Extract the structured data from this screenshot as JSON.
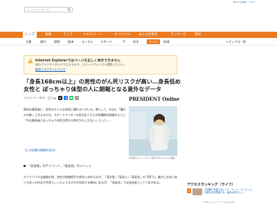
{
  "header": {
    "top_links": "Yahoo! JAPAN　ヘルプ",
    "search_placeholder": "キーワードを入力"
  },
  "nav": {
    "items": [
      "トップ",
      "速報",
      "ライブ",
      "エキスパート",
      "オリジナル",
      "みんなの意見",
      "ランキング",
      "有料"
    ],
    "active_index": 0,
    "accent_color": "#ea7a1f"
  },
  "subnav": {
    "items": [
      "主要",
      "国内",
      "国際",
      "経済",
      "エンタメ",
      "スポーツ",
      "IT",
      "科学",
      "ライフ",
      "地域"
    ],
    "active_index": 8,
    "right_label": "トピックス一覧"
  },
  "warning": {
    "title": "Internet Explorerではページを正しく表示できません",
    "body": "他のブラウザーからアクセスするか、スマートフォンから閲覧ください。",
    "link": "推奨ブラウザーについて"
  },
  "article": {
    "headline": "「身長168cm以上」の男性のがん死リスクが高い…身長低め女性と ぽっちゃり体型の人に朗報となる意外なデータ",
    "date": "3/3(日) 10:17配信",
    "comment_count": "36",
    "source": "PRESIDENT Online",
    "para1": "筋肉は最高者に、女性はスリムな体型に憧れる人がいる。果たして、本当に「憧れの対象」と言えるのか。スポーツライターの炭谷比人さんが各種統計調査をもとに「今は最高者とぽっちゃり体型が得する時代かもしれない」という……",
    "photo_link": "【この記事の画像を見る】",
    "caption": "※写真はイメージです（写真＝iStock.com/ 画像）",
    "section_heading": "「長身者」のデメリット、「低身長」のメリット",
    "para2": "かつてバブル全盛期の頃、女性が結婚相手の条件に求めたのが、「高学歴」「高収入」「高身長」の\"3高\"だ。確かにお笑い芸人も芸人の作品や作家といったようなネタを利用する傾向にあるが、「高身長」では長身者として人気がある。"
  },
  "ranking": {
    "heading": "アクセスランキング（ライフ）",
    "items": [
      {
        "rank": "1",
        "text": "【月曜を予感する】7つ・コール・パーティスト誕生の世界選べる…結末の恐ろしい",
        "src": "PHP1ドメインモーテック10/2日"
      }
    ]
  }
}
